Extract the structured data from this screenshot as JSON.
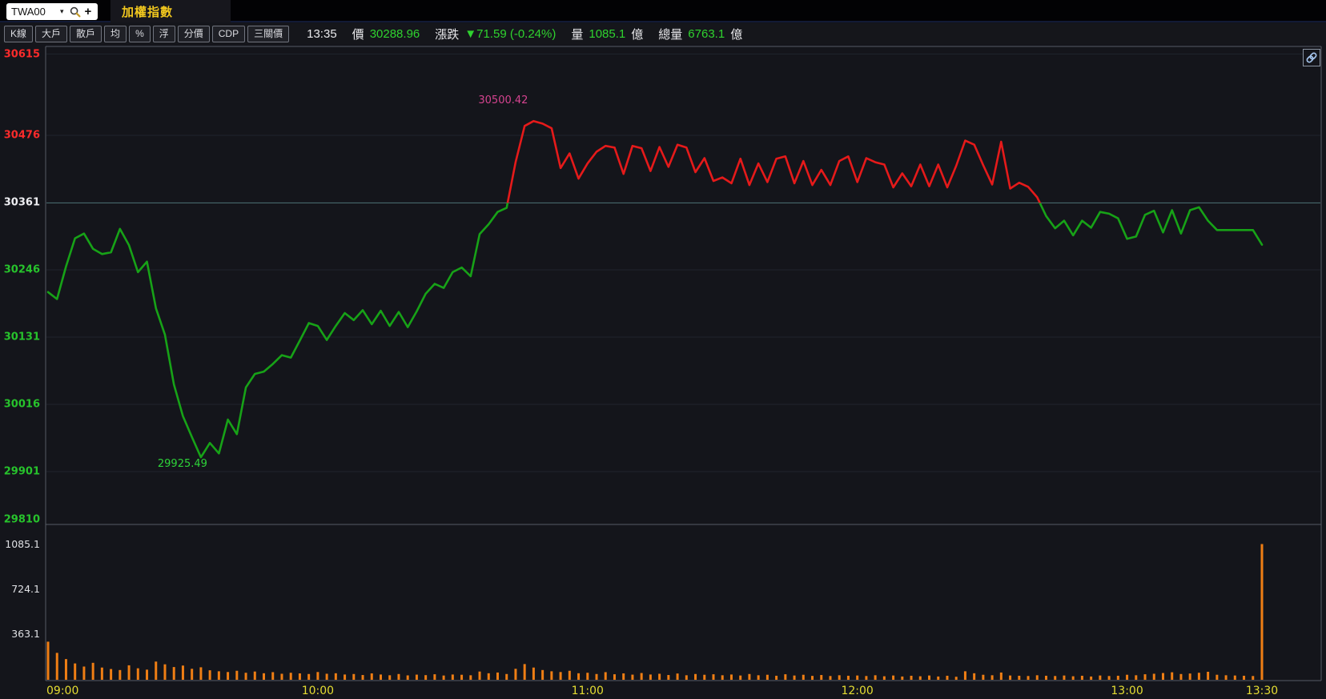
{
  "header": {
    "symbol": "TWA00",
    "caret": "▾",
    "plus": "+",
    "tab": "加權指數"
  },
  "toolbar": {
    "buttons": [
      "K線",
      "大戶",
      "散戶",
      "均",
      "%",
      "浮",
      "分價",
      "CDP",
      "三關價"
    ]
  },
  "status": {
    "time": "13:35",
    "price_label": "價",
    "price": "30288.96",
    "change_label": "漲跌",
    "change": "▼71.59 (-0.24%)",
    "vol_label": "量",
    "vol": "1085.1",
    "vol_unit": "億",
    "total_label": "總量",
    "total": "6763.1",
    "total_unit": "億"
  },
  "icons": {
    "search": "magnifier-icon",
    "add": "plus-icon",
    "link": "chain-link-icon",
    "caret": "dropdown-caret-icon"
  },
  "chart_data": {
    "type": "line",
    "title": "加權指數 intraday price / volume",
    "session_start": "09:00",
    "session_end": "13:30",
    "interval_min": 2,
    "x_ticks": [
      {
        "label": "09:00",
        "min": 0
      },
      {
        "label": "10:00",
        "min": 60
      },
      {
        "label": "11:00",
        "min": 120
      },
      {
        "label": "12:00",
        "min": 180
      },
      {
        "label": "13:00",
        "min": 240
      },
      {
        "label": "13:30",
        "min": 270
      }
    ],
    "price_axis": {
      "ticks": [
        30615,
        30476,
        30361,
        30246,
        30131,
        30016,
        29901,
        29810
      ],
      "tick_colors": [
        "#fb2b2b",
        "#fb2b2b",
        "#eeeef2",
        "#27c32c",
        "#27c32c",
        "#27c32c",
        "#27c32c",
        "#27c32c"
      ]
    },
    "volume_axis": {
      "ticks": [
        1085.1,
        724.1,
        363.1
      ]
    },
    "prev_close": 30360.55,
    "high": {
      "label": "30500.42",
      "value": 30500.42,
      "time_min": 108
    },
    "low": {
      "label": "29925.49",
      "value": 29925.49,
      "time_min": 34
    },
    "prices": [
      30208,
      30196,
      30252,
      30300,
      30308,
      30282,
      30273,
      30276,
      30316,
      30288,
      30242,
      30260,
      30180,
      30135,
      30050,
      29996,
      29960,
      29925.49,
      29950,
      29932,
      29990,
      29965,
      30045,
      30068,
      30072,
      30085,
      30100,
      30096,
      30125,
      30155,
      30150,
      30126,
      30150,
      30172,
      30160,
      30177,
      30153,
      30176,
      30150,
      30174,
      30148,
      30175,
      30205,
      30222,
      30215,
      30242,
      30250,
      30235,
      30307,
      30324,
      30345,
      30352,
      30430,
      30492,
      30500.42,
      30496,
      30488,
      30420,
      30445,
      30402,
      30428,
      30448,
      30458,
      30455,
      30410,
      30458,
      30454,
      30415,
      30456,
      30422,
      30460,
      30455,
      30413,
      30437,
      30398,
      30404,
      30394,
      30436,
      30391,
      30428,
      30396,
      30436,
      30440,
      30394,
      30432,
      30391,
      30417,
      30391,
      30432,
      30440,
      30396,
      30437,
      30430,
      30426,
      30387,
      30411,
      30389,
      30426,
      30389,
      30426,
      30387,
      30424,
      30467,
      30460,
      30425,
      30392,
      30465,
      30385,
      30395,
      30388,
      30370,
      30338,
      30317,
      30330,
      30305,
      30330,
      30318,
      30345,
      30342,
      30334,
      30299,
      30303,
      30340,
      30347,
      30310,
      30348,
      30308,
      30348,
      30353,
      30330,
      30314,
      30314,
      30314,
      30314,
      30314,
      30288.96
    ],
    "volumes": [
      300,
      210,
      160,
      125,
      100,
      130,
      92,
      80,
      72,
      110,
      86,
      75,
      140,
      118,
      96,
      108,
      82,
      94,
      70,
      62,
      56,
      66,
      50,
      60,
      46,
      55,
      42,
      50,
      45,
      40,
      56,
      42,
      46,
      36,
      40,
      32,
      45,
      36,
      30,
      40,
      29,
      35,
      31,
      38,
      28,
      36,
      34,
      30,
      60,
      46,
      52,
      40,
      82,
      120,
      92,
      72,
      62,
      56,
      66,
      46,
      50,
      40,
      55,
      38,
      45,
      35,
      48,
      36,
      42,
      32,
      44,
      30,
      40,
      34,
      38,
      30,
      36,
      28,
      40,
      30,
      34,
      26,
      38,
      28,
      34,
      25,
      32,
      24,
      30,
      26,
      28,
      24,
      30,
      22,
      28,
      20,
      26,
      22,
      28,
      20,
      26,
      18,
      62,
      46,
      34,
      30,
      52,
      28,
      26,
      24,
      30,
      26,
      24,
      28,
      22,
      26,
      20,
      28,
      24,
      26,
      34,
      30,
      38,
      42,
      48,
      54,
      40,
      44,
      50,
      58,
      34,
      30,
      28,
      26,
      24,
      1085.1
    ],
    "colors": {
      "above_prev": "#e51a1a",
      "below_prev": "#17a217",
      "volume": "#ef7e14",
      "prev_close_line": "#4e7578",
      "x_label": "#e5dd32",
      "grid": "#1f232c",
      "border": "#565b64",
      "volume_label": "#dfe0e4",
      "high_label": "#d4438f",
      "low_label": "#2ed339"
    }
  }
}
